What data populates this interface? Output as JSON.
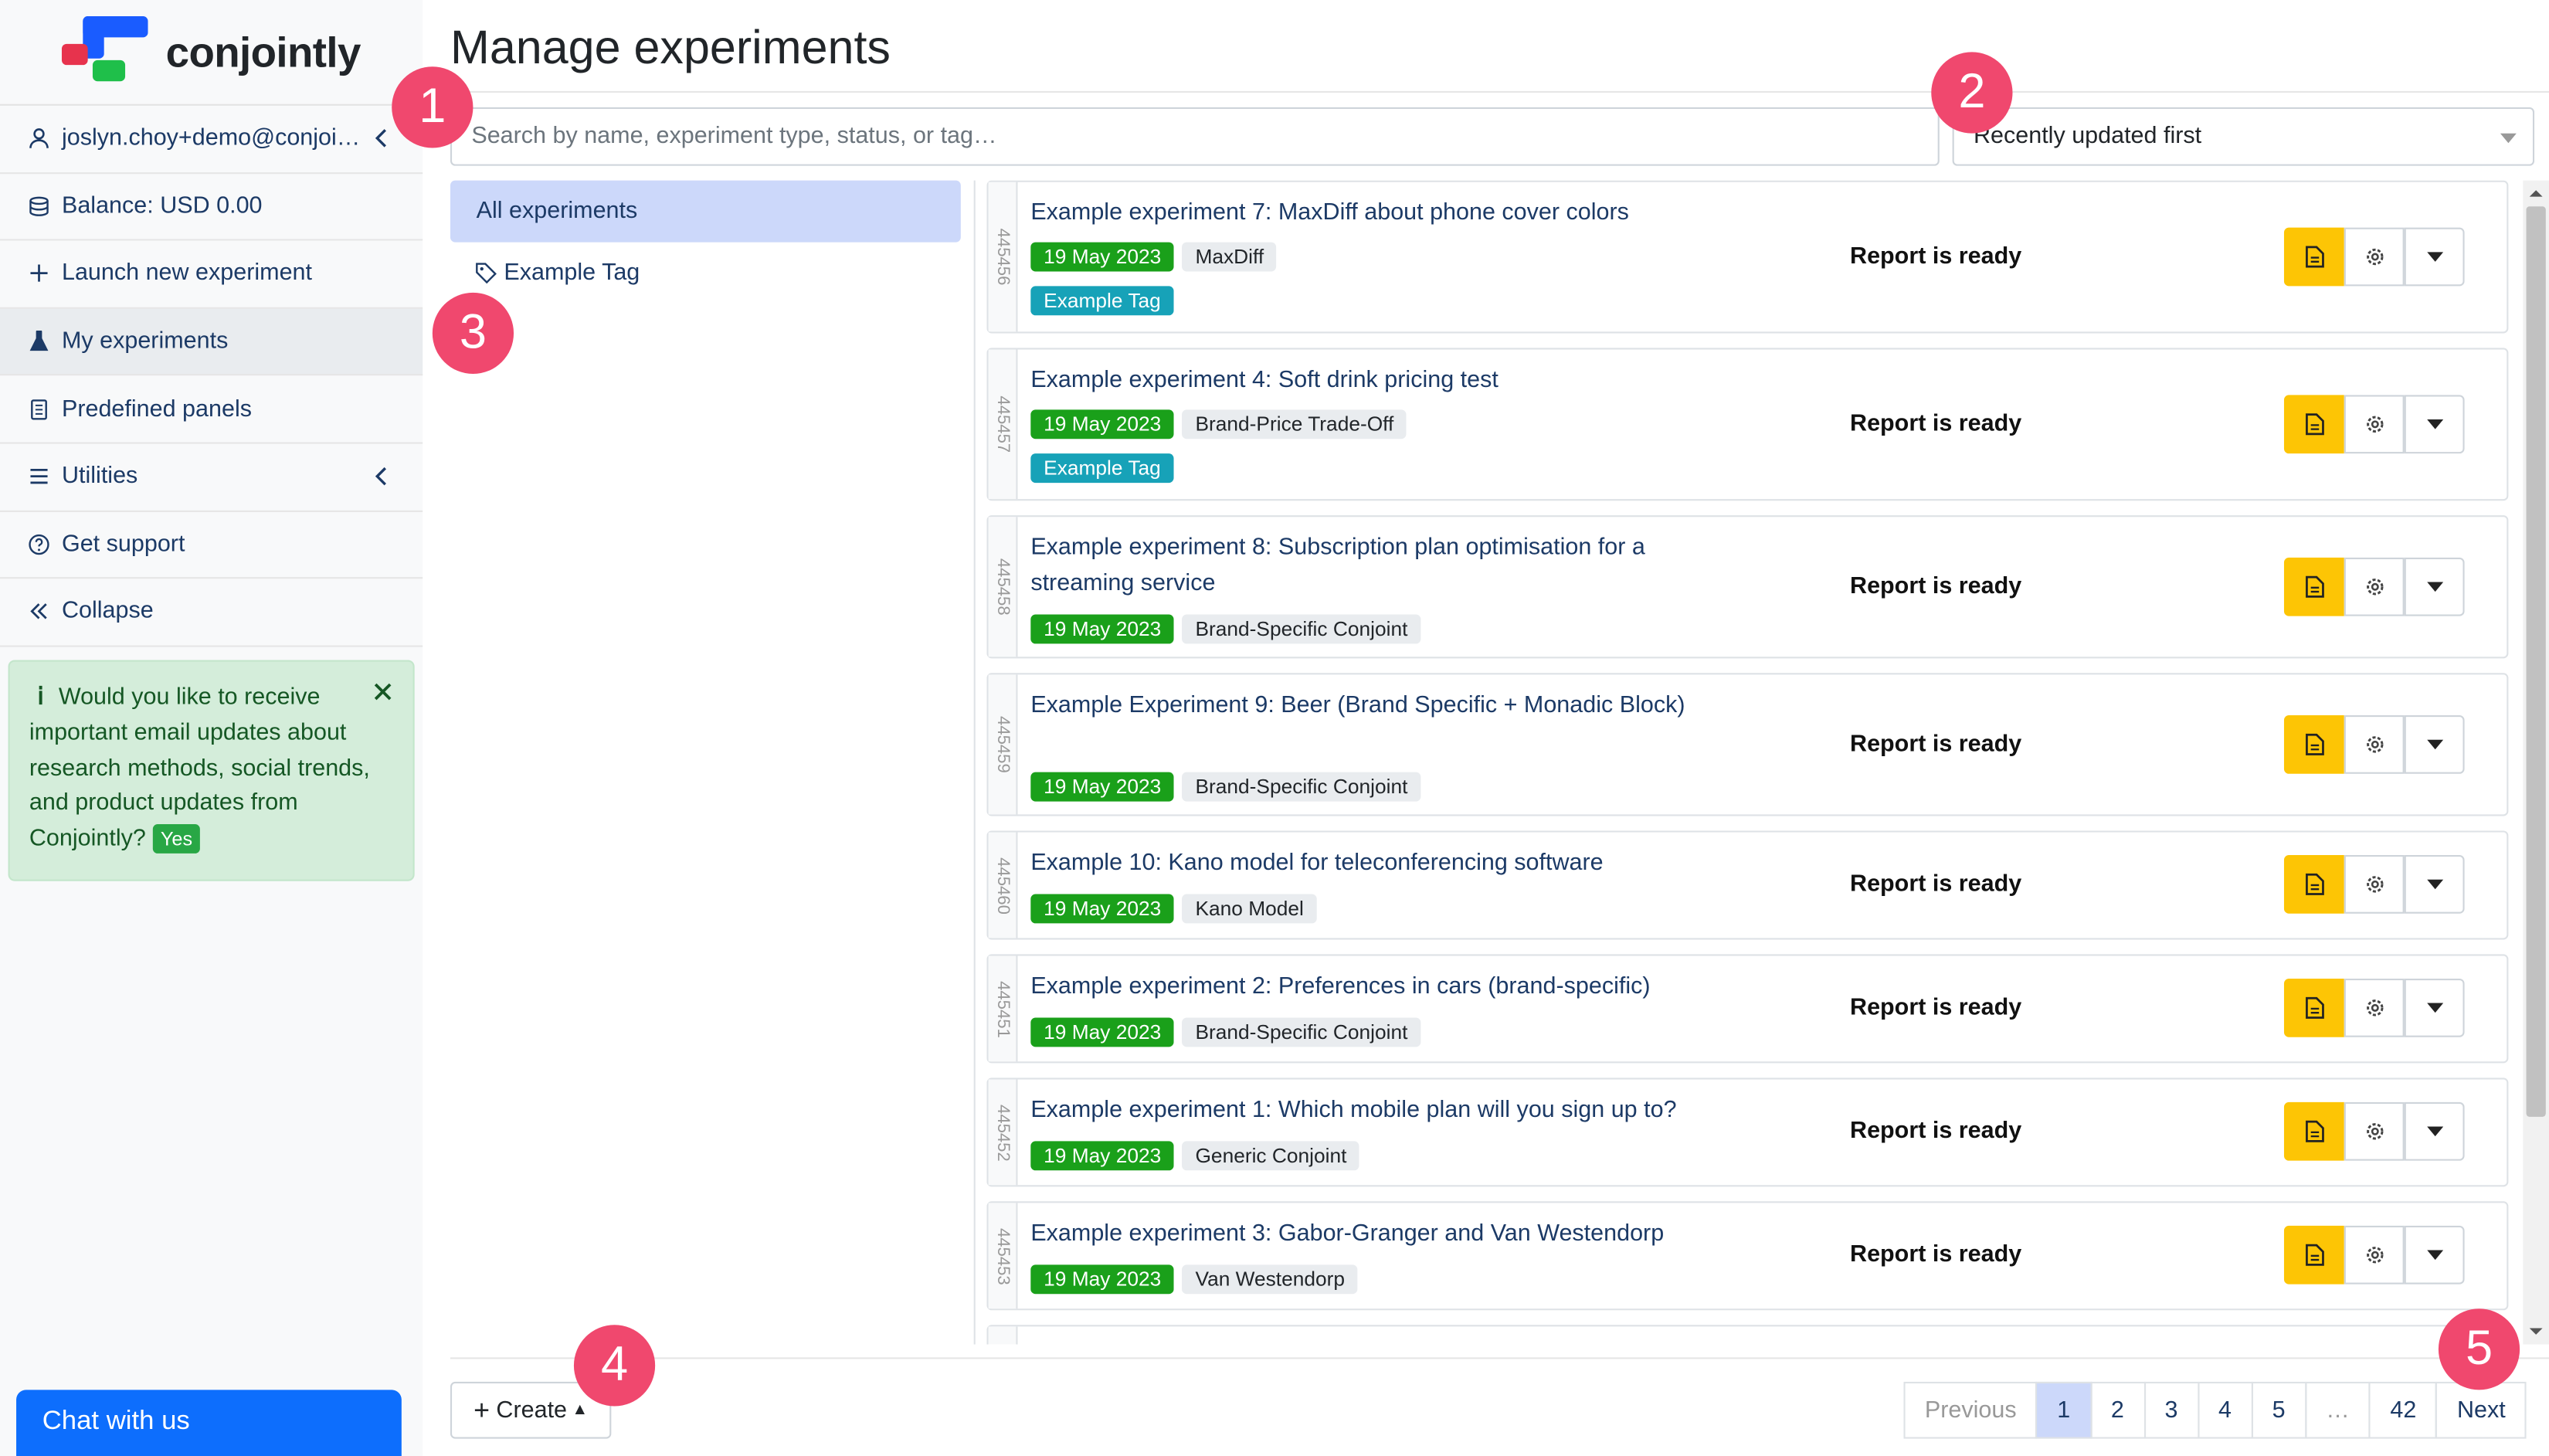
{
  "brand": {
    "name": "conjointly"
  },
  "sidebar": {
    "user": "joslyn.choy+demo@conjoi…",
    "items": [
      {
        "label": "Balance: USD 0.00",
        "icon": "coins-icon"
      },
      {
        "label": "Launch new experiment",
        "icon": "plus-icon"
      },
      {
        "label": "My experiments",
        "icon": "flask-icon"
      },
      {
        "label": "Predefined panels",
        "icon": "book-icon"
      },
      {
        "label": "Utilities",
        "icon": "list-icon"
      },
      {
        "label": "Get support",
        "icon": "question-icon"
      },
      {
        "label": "Collapse",
        "icon": "double-chevron-left-icon"
      }
    ],
    "notice": {
      "text": "Would you like to receive important email updates about research methods, social trends, and product updates from Conjointly?",
      "yes": "Yes"
    },
    "chat": "Chat with us"
  },
  "page": {
    "title": "Manage experiments",
    "search_placeholder": "Search by name, experiment type, status, or tag…",
    "sort": "Recently updated first",
    "tags": {
      "all": "All experiments",
      "example": "Example Tag"
    },
    "experiments": [
      {
        "id": "445456",
        "name": "Example experiment 7: MaxDiff about phone cover colors",
        "date": "19 May 2023",
        "type": "MaxDiff",
        "tag": "Example Tag",
        "status": "Report is ready"
      },
      {
        "id": "445457",
        "name": "Example experiment 4: Soft drink pricing test",
        "date": "19 May 2023",
        "type": "Brand-Price Trade-Off",
        "tag": "Example Tag",
        "status": "Report is ready"
      },
      {
        "id": "445458",
        "name": "Example experiment 8: Subscription plan optimisation for a streaming service",
        "date": "19 May 2023",
        "type": "Brand-Specific Conjoint",
        "tag": "",
        "status": "Report is ready"
      },
      {
        "id": "445459",
        "name": "Example Experiment 9: Beer (Brand Specific + Monadic Block)",
        "date": "19 May 2023",
        "type": "Brand-Specific Conjoint",
        "tag": "",
        "status": "Report is ready"
      },
      {
        "id": "445460",
        "name": "Example 10: Kano model for teleconferencing software",
        "date": "19 May 2023",
        "type": "Kano Model",
        "tag": "",
        "status": "Report is ready"
      },
      {
        "id": "445451",
        "name": "Example experiment 2: Preferences in cars (brand-specific)",
        "date": "19 May 2023",
        "type": "Brand-Specific Conjoint",
        "tag": "",
        "status": "Report is ready"
      },
      {
        "id": "445452",
        "name": "Example experiment 1: Which mobile plan will you sign up to?",
        "date": "19 May 2023",
        "type": "Generic Conjoint",
        "tag": "",
        "status": "Report is ready"
      },
      {
        "id": "445453",
        "name": "Example experiment 3: Gabor-Granger and Van Westendorp",
        "date": "19 May 2023",
        "type": "Van Westendorp",
        "tag": "",
        "status": "Report is ready"
      }
    ],
    "create": "Create",
    "pagination": [
      "Previous",
      "1",
      "2",
      "3",
      "4",
      "5",
      "…",
      "42",
      "Next"
    ]
  },
  "markers": [
    "1",
    "2",
    "3",
    "4",
    "5"
  ],
  "colors": {
    "accent": "#fdc505",
    "date_badge": "#1aa01a",
    "tag_badge": "#17a2b8",
    "marker": "#f0486e",
    "active_bg": "#ccd8fa"
  }
}
